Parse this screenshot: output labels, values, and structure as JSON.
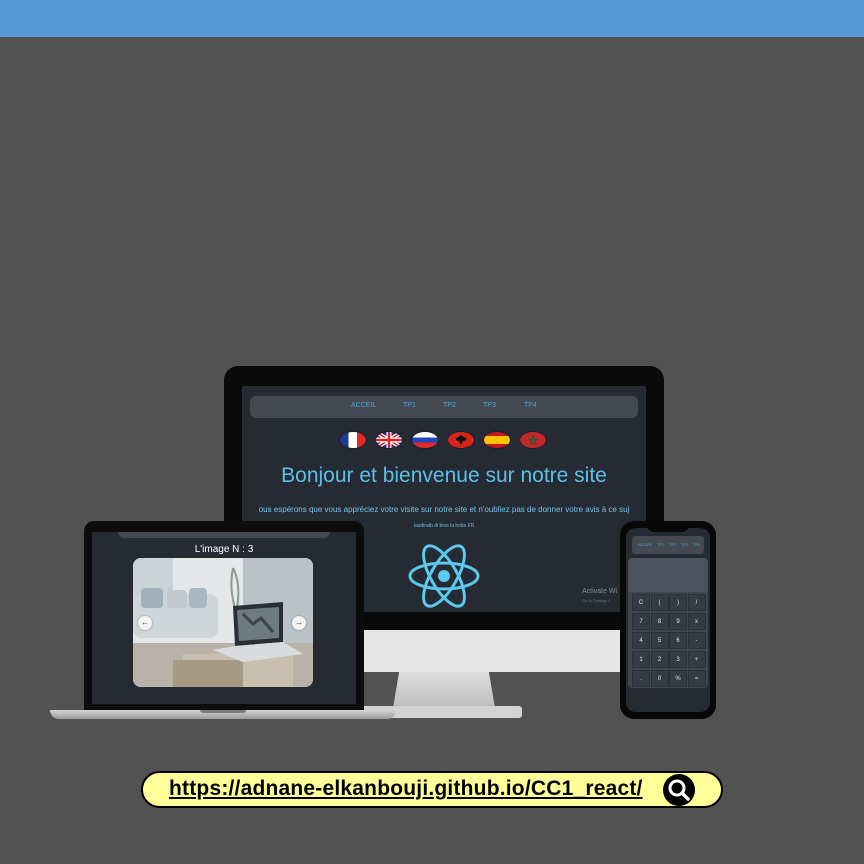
{
  "monitor": {
    "nav_items": [
      "ACCEIL",
      "TP1",
      "TP2",
      "TP3",
      "TP4"
    ],
    "flags": [
      "flag-france-icon",
      "flag-uk-icon",
      "flag-russia-icon",
      "flag-albania-icon",
      "flag-spain-icon",
      "flag-morocco-icon"
    ],
    "title": "Bonjour et bienvenue sur notre site",
    "subtitle": "ous espérons que vous appréciez votre visite sur notre site et n'oubliez pas de donner votre avis à ce suj",
    "small_text": "tasdiratb di bios la hotia FR",
    "activate_line1": "Activate Wi",
    "activate_line2": "Go to Settings t"
  },
  "laptop": {
    "caption": "L'image N : 3",
    "prev_arrow": "←",
    "next_arrow": "→"
  },
  "phone": {
    "nav_items": [
      "ACCEIL",
      "TP1",
      "TP2",
      "TP3",
      "TP4"
    ],
    "keys": [
      "C",
      "(",
      ")",
      "/",
      "7",
      "8",
      "9",
      "x",
      "4",
      "5",
      "6",
      "-",
      "1",
      "2",
      "3",
      "+",
      ".",
      "0",
      "%",
      "="
    ]
  },
  "url": "https://adnane-elkanbouji.github.io/CC1_react/",
  "colors": {
    "top_bar": "#559ad9",
    "background": "#525252",
    "screen": "#262b33",
    "accent_blue": "#5cc0e6",
    "url_bar": "#ffff99"
  }
}
